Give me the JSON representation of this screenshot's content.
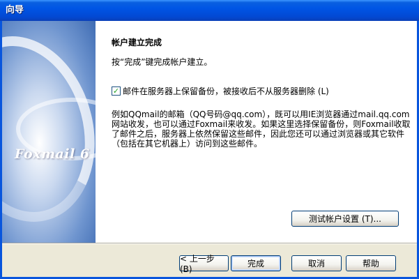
{
  "window": {
    "title": "向导"
  },
  "side_panel": {
    "logo_text": "Foxmail 6"
  },
  "content": {
    "heading": "帐户建立完成",
    "instruction": "按“完成”键完成帐户建立。",
    "checkbox": {
      "checked": true,
      "label": "邮件在服务器上保留备份，被接收后不从服务器删除 (L)"
    },
    "description": "例如QQmail的邮箱（QQ号码@qq.com），既可以用IE浏览器通过mail.qq.com网站收发，也可以通过Foxmail来收发。如果这里选择保留备份，则Foxmail收取了邮件之后，服务器上依然保留这些邮件，因此您还可以通过浏览器或其它软件（包括在其它机器上）访问到这些邮件。",
    "test_button": "测试帐户设置 (T)..."
  },
  "footer": {
    "back_button": "< 上一步 (B)",
    "finish_button": "完成",
    "cancel_button": "取消",
    "help_button": "帮助"
  },
  "colors": {
    "title_bar": "#0055e5",
    "dialog_bg": "#ece9d8",
    "check_mark": "#21a121"
  }
}
